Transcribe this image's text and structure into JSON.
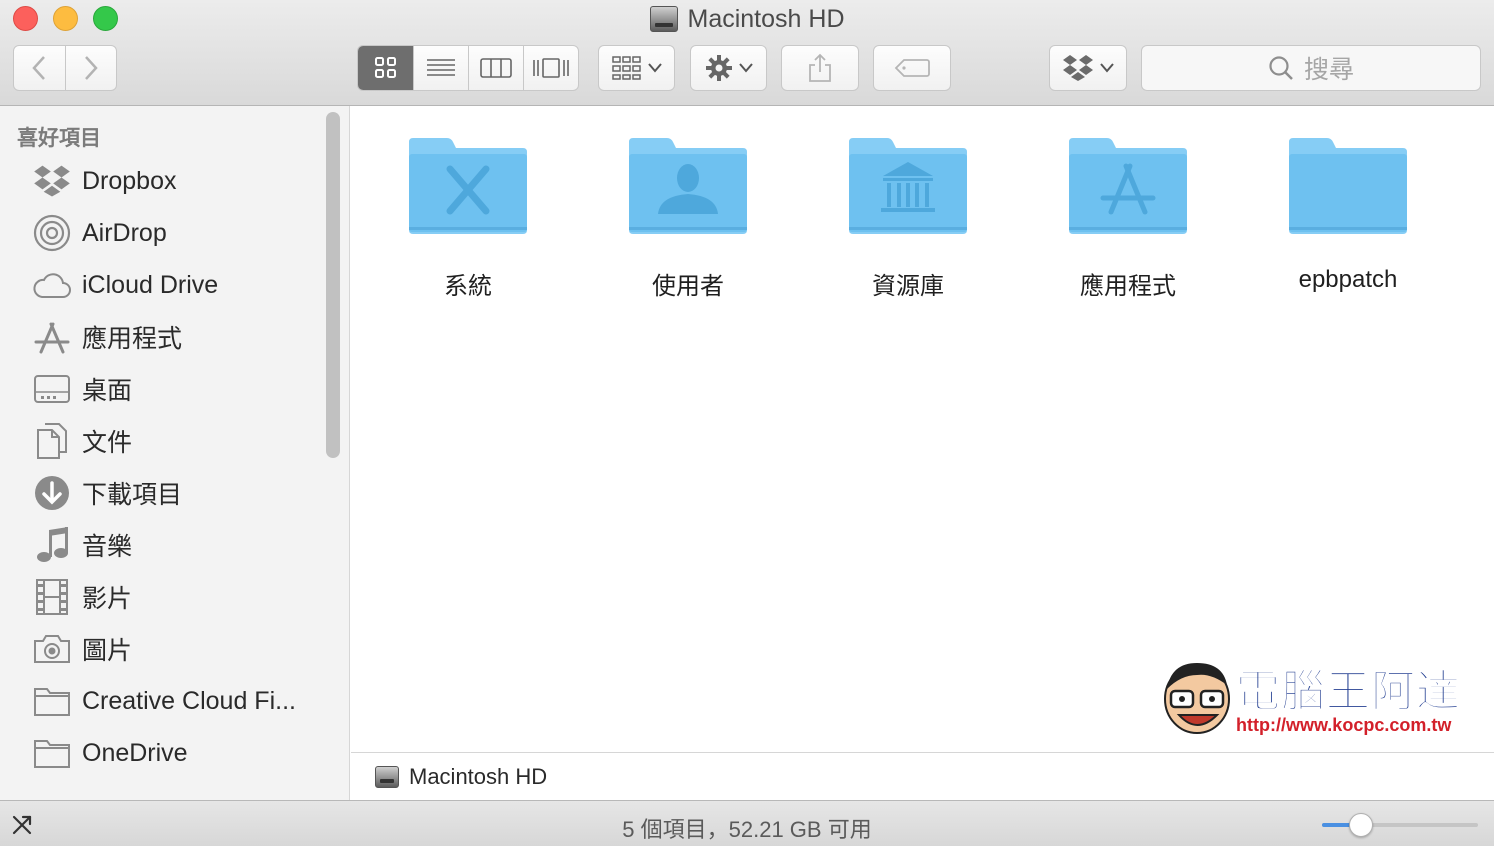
{
  "window": {
    "title": "Macintosh HD",
    "controls": [
      "close",
      "minimize",
      "zoom"
    ]
  },
  "toolbar": {
    "back_icon": "chevron-left-icon",
    "forward_icon": "chevron-right-icon",
    "view_modes": [
      "icon-view",
      "list-view",
      "column-view",
      "cover-flow-view"
    ],
    "active_view": "icon-view",
    "arrange_icon": "arrange-grid-icon",
    "action_icon": "gear-icon",
    "share_icon": "share-icon",
    "tag_icon": "tag-icon",
    "dropbox_icon": "dropbox-icon",
    "search_placeholder": "搜尋"
  },
  "sidebar": {
    "heading": "喜好項目",
    "items": [
      {
        "label": "Dropbox",
        "icon": "dropbox-icon"
      },
      {
        "label": "AirDrop",
        "icon": "airdrop-icon"
      },
      {
        "label": "iCloud Drive",
        "icon": "cloud-icon"
      },
      {
        "label": "應用程式",
        "icon": "applications-icon"
      },
      {
        "label": "桌面",
        "icon": "desktop-icon"
      },
      {
        "label": "文件",
        "icon": "documents-icon"
      },
      {
        "label": "下載項目",
        "icon": "download-icon"
      },
      {
        "label": "音樂",
        "icon": "music-icon"
      },
      {
        "label": "影片",
        "icon": "film-icon"
      },
      {
        "label": "圖片",
        "icon": "camera-icon"
      },
      {
        "label": "Creative Cloud Fi...",
        "icon": "folder-icon"
      },
      {
        "label": "OneDrive",
        "icon": "folder-icon"
      }
    ]
  },
  "folders": [
    {
      "name": "系統",
      "glyph": "system-x-icon"
    },
    {
      "name": "使用者",
      "glyph": "user-silhouette-icon"
    },
    {
      "name": "資源庫",
      "glyph": "library-building-icon"
    },
    {
      "name": "應用程式",
      "glyph": "app-store-a-icon"
    },
    {
      "name": "epbpatch",
      "glyph": "plain-folder-icon"
    }
  ],
  "watermark": {
    "brand": "電腦王阿達",
    "url": "http://www.kocpc.com.tw"
  },
  "pathbar": {
    "location": "Macintosh HD"
  },
  "status": {
    "text": "5 個項目，52.21 GB 可用",
    "zoom_level": 0.25
  },
  "colors": {
    "folder_blue": "#6cc2f2",
    "folder_tab": "#8fd2f7",
    "close": "#fc605c",
    "minimize": "#fdbc40",
    "zoom": "#34c84a",
    "slider_accent": "#4a90e2"
  }
}
